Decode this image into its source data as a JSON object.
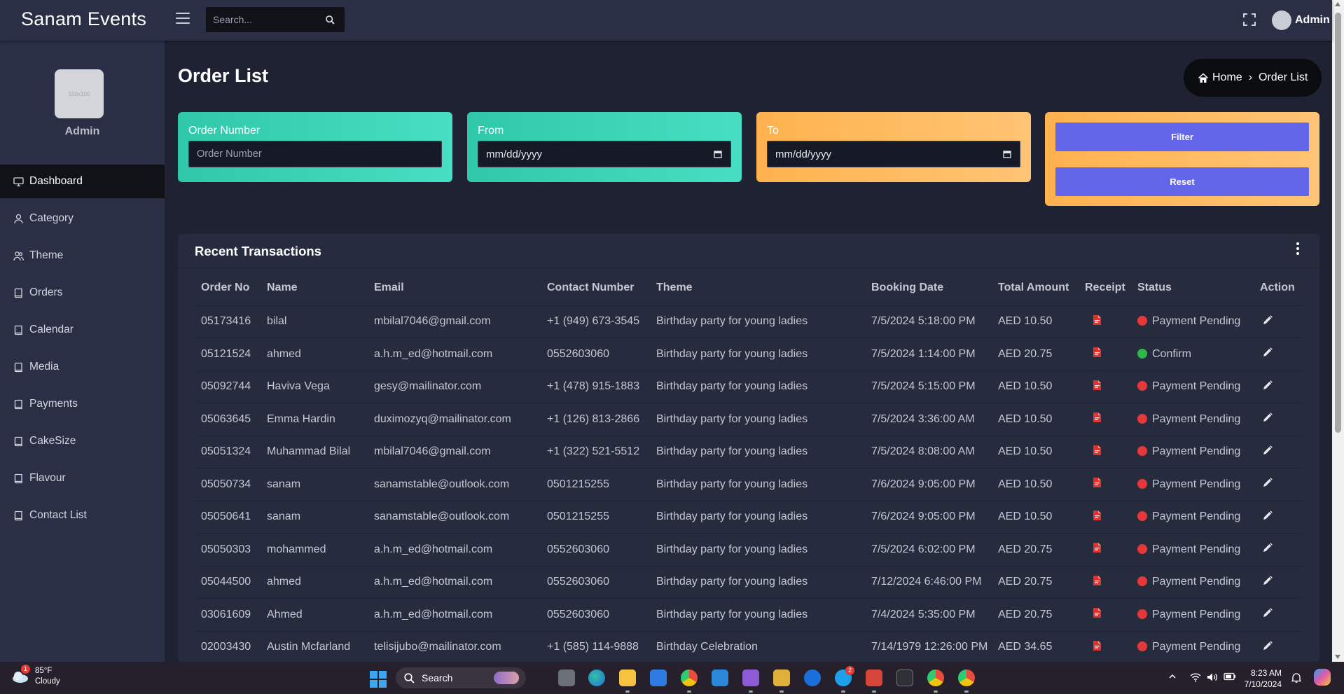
{
  "app": {
    "brand": "Sanam Events",
    "search_placeholder": "Search...",
    "user_name": "Admin"
  },
  "sidebar": {
    "avatar_text": "100x100",
    "user_name": "Admin",
    "items": [
      {
        "label": "Dashboard",
        "icon": "monitor-icon",
        "active": true
      },
      {
        "label": "Category",
        "icon": "user-icon"
      },
      {
        "label": "Theme",
        "icon": "users-icon"
      },
      {
        "label": "Orders",
        "icon": "book-icon"
      },
      {
        "label": "Calendar",
        "icon": "book-icon"
      },
      {
        "label": "Media",
        "icon": "book-icon"
      },
      {
        "label": "Payments",
        "icon": "book-icon"
      },
      {
        "label": "CakeSize",
        "icon": "book-icon"
      },
      {
        "label": "Flavour",
        "icon": "book-icon"
      },
      {
        "label": "Contact List",
        "icon": "book-icon"
      }
    ]
  },
  "page": {
    "title": "Order List",
    "breadcrumb": {
      "home": "Home",
      "current": "Order List"
    }
  },
  "filters": {
    "order_number": {
      "label": "Order Number",
      "placeholder": "Order Number"
    },
    "from": {
      "label": "From",
      "placeholder": "mm/dd/yyyy"
    },
    "to": {
      "label": "To",
      "placeholder": "mm/dd/yyyy"
    },
    "filter_button": "Filter",
    "reset_button": "Reset"
  },
  "transactions": {
    "title": "Recent Transactions",
    "columns": [
      "Order No",
      "Name",
      "Email",
      "Contact Number",
      "Theme",
      "Booking Date",
      "Total Amount",
      "Receipt",
      "Status",
      "Action"
    ],
    "rows": [
      {
        "order_no": "05173416",
        "name": "bilal",
        "email": "mbilal7046@gmail.com",
        "contact": "+1 (949) 673-3545",
        "theme": "Birthday party for young ladies",
        "date": "7/5/2024 5:18:00 PM",
        "amount": "AED 10.50",
        "status": "Payment Pending",
        "status_color": "#e5383b"
      },
      {
        "order_no": "05121524",
        "name": "ahmed",
        "email": "a.h.m_ed@hotmail.com",
        "contact": "0552603060",
        "theme": "Birthday party for young ladies",
        "date": "7/5/2024 1:14:00 PM",
        "amount": "AED 20.75",
        "status": "Confirm",
        "status_color": "#2fb84a"
      },
      {
        "order_no": "05092744",
        "name": "Haviva Vega",
        "email": "gesy@mailinator.com",
        "contact": "+1 (478) 915-1883",
        "theme": "Birthday party for young ladies",
        "date": "7/5/2024 5:15:00 PM",
        "amount": "AED 10.50",
        "status": "Payment Pending",
        "status_color": "#e5383b"
      },
      {
        "order_no": "05063645",
        "name": "Emma Hardin",
        "email": "duximozyq@mailinator.com",
        "contact": "+1 (126) 813-2866",
        "theme": "Birthday party for young ladies",
        "date": "7/5/2024 3:36:00 AM",
        "amount": "AED 10.50",
        "status": "Payment Pending",
        "status_color": "#e5383b"
      },
      {
        "order_no": "05051324",
        "name": "Muhammad Bilal",
        "email": "mbilal7046@gmail.com",
        "contact": "+1 (322) 521-5512",
        "theme": "Birthday party for young ladies",
        "date": "7/5/2024 8:08:00 AM",
        "amount": "AED 10.50",
        "status": "Payment Pending",
        "status_color": "#e5383b"
      },
      {
        "order_no": "05050734",
        "name": "sanam",
        "email": "sanamstable@outlook.com",
        "contact": "0501215255",
        "theme": "Birthday party for young ladies",
        "date": "7/6/2024 9:05:00 PM",
        "amount": "AED 10.50",
        "status": "Payment Pending",
        "status_color": "#e5383b"
      },
      {
        "order_no": "05050641",
        "name": "sanam",
        "email": "sanamstable@outlook.com",
        "contact": "0501215255",
        "theme": "Birthday party for young ladies",
        "date": "7/6/2024 9:05:00 PM",
        "amount": "AED 10.50",
        "status": "Payment Pending",
        "status_color": "#e5383b"
      },
      {
        "order_no": "05050303",
        "name": "mohammed",
        "email": "a.h.m_ed@hotmail.com",
        "contact": "0552603060",
        "theme": "Birthday party for young ladies",
        "date": "7/5/2024 6:02:00 PM",
        "amount": "AED 20.75",
        "status": "Payment Pending",
        "status_color": "#e5383b"
      },
      {
        "order_no": "05044500",
        "name": "ahmed",
        "email": "a.h.m_ed@hotmail.com",
        "contact": "0552603060",
        "theme": "Birthday party for young ladies",
        "date": "7/12/2024 6:46:00 PM",
        "amount": "AED 20.75",
        "status": "Payment Pending",
        "status_color": "#e5383b"
      },
      {
        "order_no": "03061609",
        "name": "Ahmed",
        "email": "a.h.m_ed@hotmail.com",
        "contact": "0552603060",
        "theme": "Birthday party for young ladies",
        "date": "7/4/2024 5:35:00 PM",
        "amount": "AED 20.75",
        "status": "Payment Pending",
        "status_color": "#e5383b"
      },
      {
        "order_no": "02003430",
        "name": "Austin Mcfarland",
        "email": "telisijubo@mailinator.com",
        "contact": "+1 (585) 114-9888",
        "theme": "Birthday Celebration",
        "date": "7/14/1979 12:26:00 PM",
        "amount": "AED 34.65",
        "status": "Payment Pending",
        "status_color": "#e5383b"
      }
    ]
  },
  "taskbar": {
    "weather_temp": "85°F",
    "weather_desc": "Cloudy",
    "weather_badge": "1",
    "search_label": "Search",
    "skype_badge": "2",
    "time": "8:23 AM",
    "date": "7/10/2024"
  }
}
